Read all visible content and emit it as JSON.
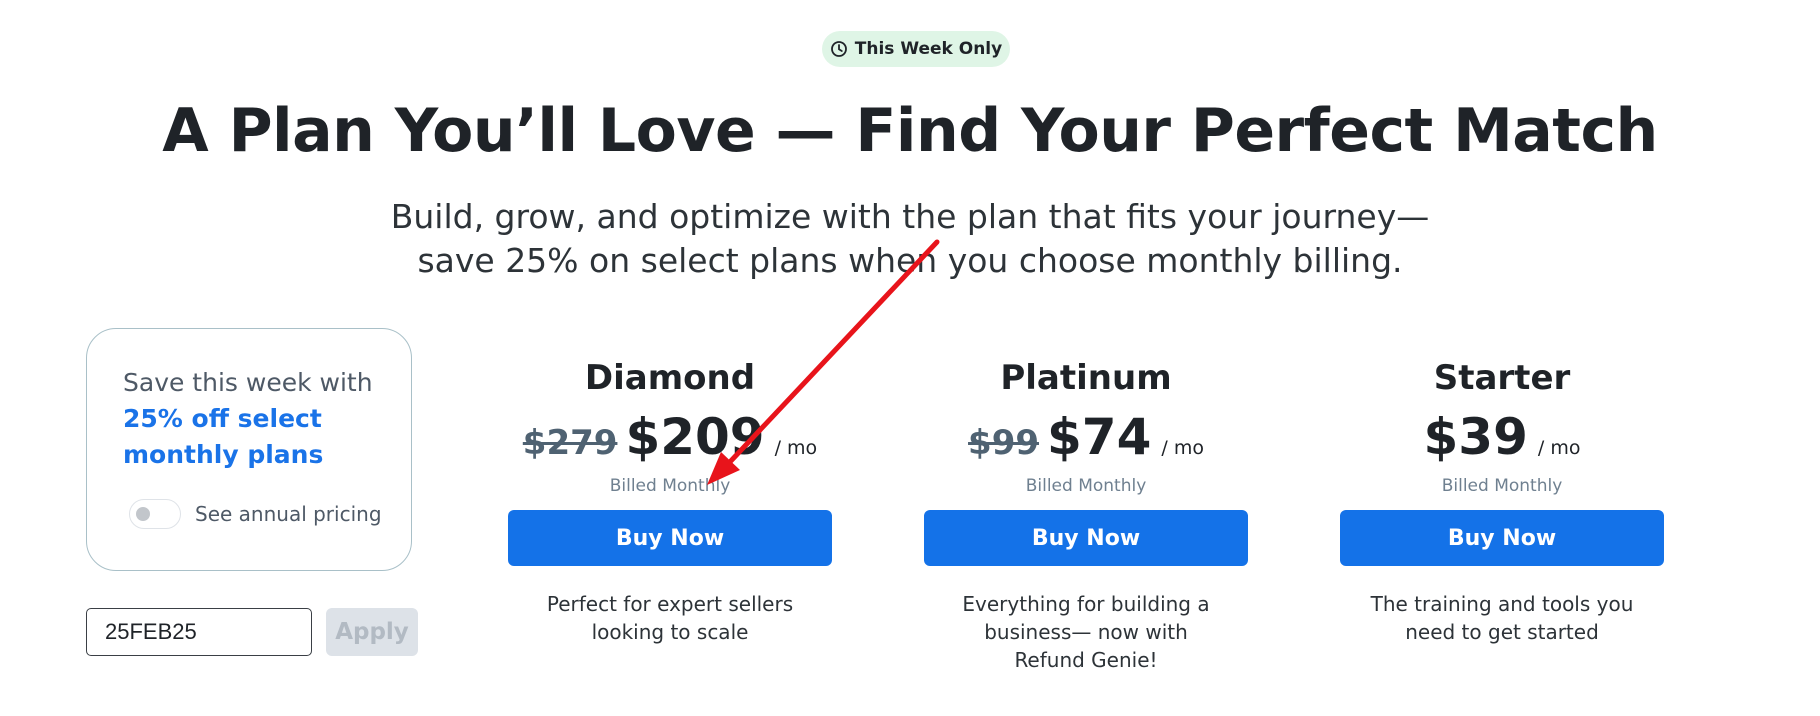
{
  "badge": {
    "icon": "clock-icon",
    "text": "This Week Only"
  },
  "header": {
    "title": "A Plan You’ll Love — Find Your Perfect Match",
    "subtitle_line1": "Build, grow, and optimize with the plan that fits your journey—",
    "subtitle_line2": "save 25% on select plans when you choose monthly billing."
  },
  "promo": {
    "text": "Save this week with",
    "highlight": "25% off select monthly plans",
    "toggle_label": "See annual pricing",
    "toggle_on": false
  },
  "coupon": {
    "value": "25FEB25",
    "apply_label": "Apply"
  },
  "plans": [
    {
      "name": "Diamond",
      "old_price": "$279",
      "price": "$209",
      "period": "/ mo",
      "billing": "Billed Monthly",
      "button": "Buy Now",
      "description": "Perfect for expert sellers looking to scale"
    },
    {
      "name": "Platinum",
      "old_price": "$99",
      "price": "$74",
      "period": "/ mo",
      "billing": "Billed Monthly",
      "button": "Buy Now",
      "description": "Everything for building a business— now with Refund Genie!"
    },
    {
      "name": "Starter",
      "old_price": "",
      "price": "$39",
      "period": "/ mo",
      "billing": "Billed Monthly",
      "button": "Buy Now",
      "description": "The training and tools you need to get started"
    }
  ],
  "annotation": {
    "color": "#e8141b"
  },
  "colors": {
    "accent": "#1472e8",
    "badge_bg": "#dff5e6",
    "highlight": "#1a73e8"
  }
}
